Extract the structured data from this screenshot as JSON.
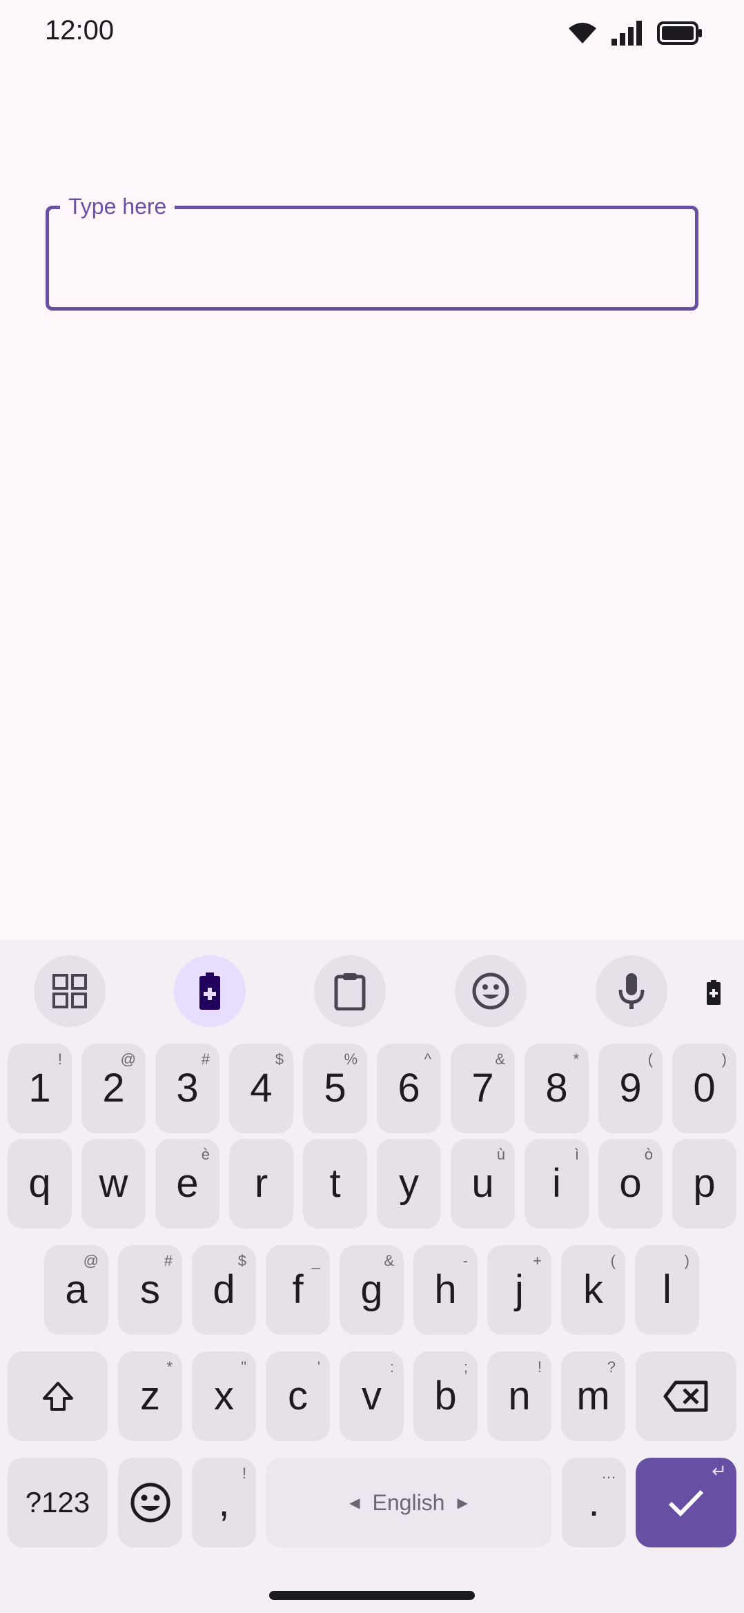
{
  "status_bar": {
    "time": "12:00",
    "icons": [
      "wifi-icon",
      "cellular-signal-icon",
      "battery-full-icon"
    ]
  },
  "text_field": {
    "label": "Type here",
    "value": ""
  },
  "keyboard": {
    "toolbar": {
      "items": [
        "apps-grid-icon",
        "battery-plus-icon",
        "clipboard-icon",
        "emoji-icon",
        "microphone-icon",
        "battery-plus-icon"
      ]
    },
    "row_numbers": [
      {
        "key": "1",
        "hint": "!"
      },
      {
        "key": "2",
        "hint": "@"
      },
      {
        "key": "3",
        "hint": "#"
      },
      {
        "key": "4",
        "hint": "$"
      },
      {
        "key": "5",
        "hint": "%"
      },
      {
        "key": "6",
        "hint": "^"
      },
      {
        "key": "7",
        "hint": "&"
      },
      {
        "key": "8",
        "hint": "*"
      },
      {
        "key": "9",
        "hint": "("
      },
      {
        "key": "0",
        "hint": ")"
      }
    ],
    "row_top": [
      {
        "key": "q",
        "hint": ""
      },
      {
        "key": "w",
        "hint": ""
      },
      {
        "key": "e",
        "hint": "è"
      },
      {
        "key": "r",
        "hint": ""
      },
      {
        "key": "t",
        "hint": ""
      },
      {
        "key": "y",
        "hint": ""
      },
      {
        "key": "u",
        "hint": "ù"
      },
      {
        "key": "i",
        "hint": "ì"
      },
      {
        "key": "o",
        "hint": "ò"
      },
      {
        "key": "p",
        "hint": ""
      }
    ],
    "row_home": [
      {
        "key": "a",
        "hint": "@"
      },
      {
        "key": "s",
        "hint": "#"
      },
      {
        "key": "d",
        "hint": "$"
      },
      {
        "key": "f",
        "hint": "_"
      },
      {
        "key": "g",
        "hint": "&"
      },
      {
        "key": "h",
        "hint": "-"
      },
      {
        "key": "j",
        "hint": "+"
      },
      {
        "key": "k",
        "hint": "("
      },
      {
        "key": "l",
        "hint": ")"
      }
    ],
    "row_bottom": [
      {
        "key": "z",
        "hint": "*"
      },
      {
        "key": "x",
        "hint": "\""
      },
      {
        "key": "c",
        "hint": "'"
      },
      {
        "key": "v",
        "hint": ":"
      },
      {
        "key": "b",
        "hint": ";"
      },
      {
        "key": "n",
        "hint": "!"
      },
      {
        "key": "m",
        "hint": "?"
      }
    ],
    "shift_icon": "shift-icon",
    "backspace_icon": "backspace-icon",
    "symbols_label": "?123",
    "emoji_icon": "emoji-icon",
    "comma": {
      "key": ",",
      "hint": "!"
    },
    "space_label": "English",
    "period": {
      "key": ".",
      "hint": "…"
    },
    "enter_icon": "check-icon",
    "enter_hint": "↵"
  },
  "colors": {
    "accent": "#6750a4",
    "background": "#fdf7fc",
    "keyboard_bg": "#f4eff4",
    "key_bg": "#e6e0e7"
  }
}
